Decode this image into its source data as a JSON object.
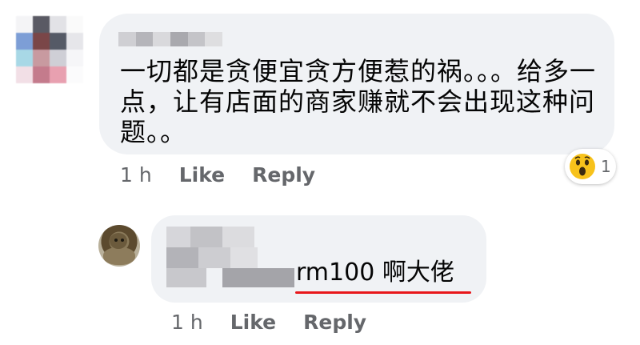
{
  "comment": {
    "text": "一切都是贪便宜贪方便惹的祸。。。给多一点，让有店面的商家赚就不会出现这种问题。。",
    "time": "1 h",
    "like_label": "Like",
    "reply_label": "Reply",
    "reaction": {
      "icon": "wow-emoji-icon",
      "count": "1"
    }
  },
  "reply": {
    "text": "rm100 啊大佬",
    "time": "1 h",
    "like_label": "Like",
    "reply_label": "Reply",
    "highlight_color": "#e8171b"
  },
  "colors": {
    "bubble": "#f0f2f5",
    "meta_text": "#65676b",
    "body_text": "#050505"
  }
}
